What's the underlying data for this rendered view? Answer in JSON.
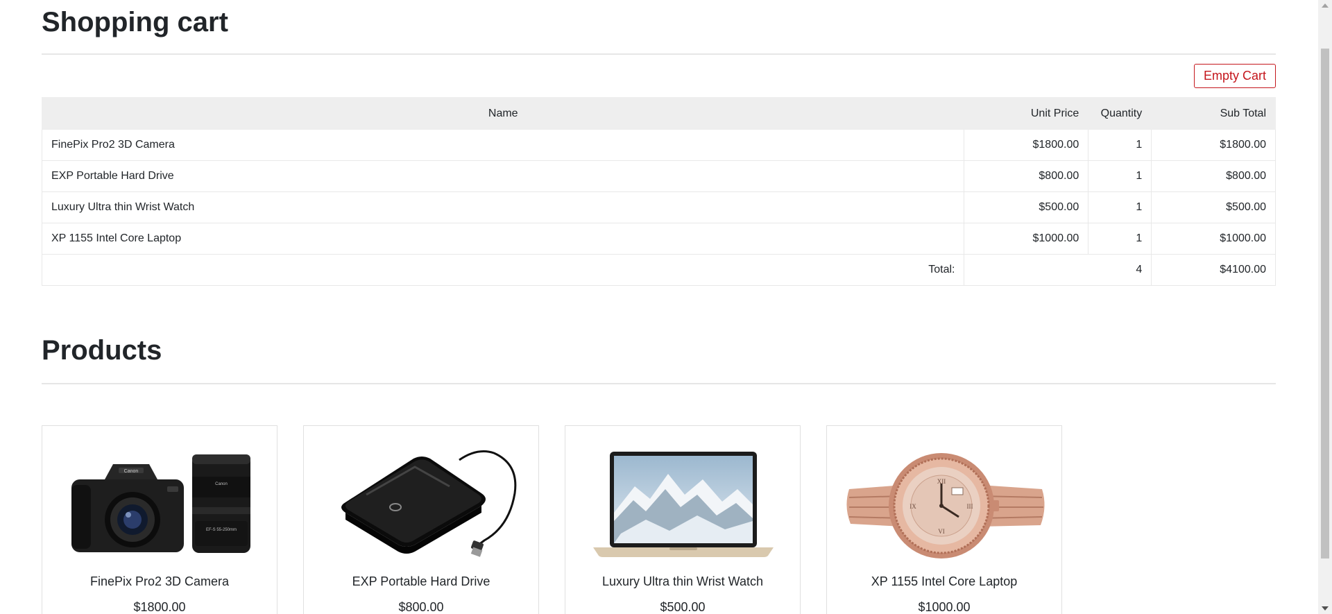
{
  "cart": {
    "title": "Shopping cart",
    "empty_button": "Empty Cart",
    "columns": {
      "name": "Name",
      "unit_price": "Unit Price",
      "quantity": "Quantity",
      "sub_total": "Sub Total"
    },
    "rows": [
      {
        "name": "FinePix Pro2 3D Camera",
        "unit_price": "$1800.00",
        "quantity": "1",
        "sub_total": "$1800.00"
      },
      {
        "name": "EXP Portable Hard Drive",
        "unit_price": "$800.00",
        "quantity": "1",
        "sub_total": "$800.00"
      },
      {
        "name": "Luxury Ultra thin Wrist Watch",
        "unit_price": "$500.00",
        "quantity": "1",
        "sub_total": "$500.00"
      },
      {
        "name": "XP 1155 Intel Core Laptop",
        "unit_price": "$1000.00",
        "quantity": "1",
        "sub_total": "$1000.00"
      }
    ],
    "total": {
      "label": "Total:",
      "quantity": "4",
      "amount": "$4100.00"
    }
  },
  "products": {
    "title": "Products",
    "items": [
      {
        "name": "FinePix Pro2 3D Camera",
        "price": "$1800.00",
        "icon": "camera-image"
      },
      {
        "name": "EXP Portable Hard Drive",
        "price": "$800.00",
        "icon": "hard-drive-image"
      },
      {
        "name": "Luxury Ultra thin Wrist Watch",
        "price": "$500.00",
        "icon": "laptop-image"
      },
      {
        "name": "XP 1155 Intel Core Laptop",
        "price": "$1000.00",
        "icon": "wrist-watch-image"
      }
    ]
  },
  "colors": {
    "accent_red": "#c4161c",
    "header_bg": "#eeeeee",
    "border": "#e0e0e0"
  }
}
